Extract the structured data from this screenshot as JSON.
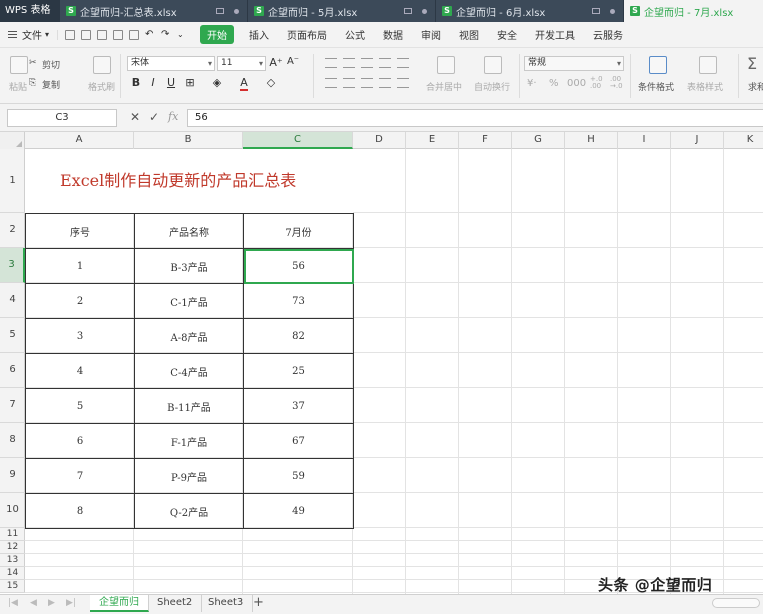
{
  "tabbar": {
    "app_name": "WPS 表格",
    "tabs": [
      {
        "label": "企望而归-汇总表.xlsx",
        "active": false
      },
      {
        "label": "企望而归 - 5月.xlsx",
        "active": false
      },
      {
        "label": "企望而归 - 6月.xlsx",
        "active": false
      },
      {
        "label": "企望而归 - 7月.xlsx",
        "active": true
      }
    ]
  },
  "menubar": {
    "file_label": "文件",
    "items": [
      "开始",
      "插入",
      "页面布局",
      "公式",
      "数据",
      "审阅",
      "视图",
      "安全",
      "开发工具",
      "云服务"
    ],
    "active": "开始"
  },
  "ribbon": {
    "paste": "粘贴",
    "cut": "剪切",
    "copy": "复制",
    "format_painter": "格式刷",
    "font_name": "宋体",
    "font_size": "11",
    "bold": "B",
    "italic": "I",
    "underline": "U",
    "merge_center": "合并居中",
    "wrap_text": "自动换行",
    "number_format": "常规",
    "conditional_format": "条件格式",
    "table_style": "表格样式",
    "sum": "求和"
  },
  "formula_bar": {
    "name_box": "C3",
    "cancel": "✕",
    "confirm": "✓",
    "fx": "fx",
    "value": "56"
  },
  "grid": {
    "columns": [
      "A",
      "B",
      "C",
      "D",
      "E",
      "F",
      "G",
      "H",
      "I",
      "J",
      "K"
    ],
    "rows": [
      "1",
      "2",
      "3",
      "4",
      "5",
      "6",
      "7",
      "8",
      "9",
      "10",
      "11",
      "12",
      "13",
      "14",
      "15"
    ],
    "selected_column": "C",
    "selected_row": "3",
    "title": "Excel制作自动更新的产品汇总表",
    "table": {
      "headers": [
        "序号",
        "产品名称",
        "7月份"
      ],
      "rows": [
        [
          "1",
          "B-3产品",
          "56"
        ],
        [
          "2",
          "C-1产品",
          "73"
        ],
        [
          "3",
          "A-8产品",
          "82"
        ],
        [
          "4",
          "C-4产品",
          "25"
        ],
        [
          "5",
          "B-11产品",
          "37"
        ],
        [
          "6",
          "F-1产品",
          "67"
        ],
        [
          "7",
          "P-9产品",
          "59"
        ],
        [
          "8",
          "Q-2产品",
          "49"
        ]
      ]
    }
  },
  "sheets": {
    "tabs": [
      "企望而归",
      "Sheet2",
      "Sheet3"
    ],
    "active": "企望而归",
    "add": "+"
  },
  "watermark": "头条 @企望而归",
  "colors": {
    "accent": "#2fa84f",
    "title_red": "#c0392b",
    "tabbar_bg": "#3c4a59"
  }
}
